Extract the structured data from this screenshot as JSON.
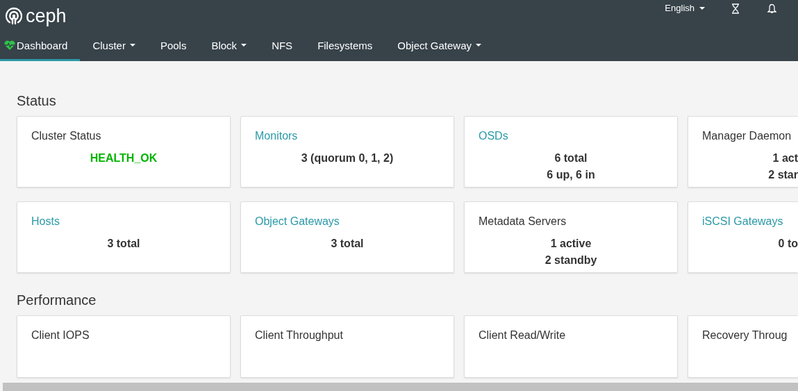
{
  "brand": "ceph",
  "language": {
    "label": "English"
  },
  "nav": [
    {
      "label": "Dashboard",
      "selected": true,
      "dropdown": false
    },
    {
      "label": "Cluster",
      "selected": false,
      "dropdown": true
    },
    {
      "label": "Pools",
      "selected": false,
      "dropdown": false
    },
    {
      "label": "Block",
      "selected": false,
      "dropdown": true
    },
    {
      "label": "NFS",
      "selected": false,
      "dropdown": false
    },
    {
      "label": "Filesystems",
      "selected": false,
      "dropdown": false
    },
    {
      "label": "Object Gateway",
      "selected": false,
      "dropdown": true
    }
  ],
  "sections": [
    {
      "title": "Status",
      "cards": [
        {
          "title": "Cluster Status",
          "link": false,
          "kind": "health",
          "values": [
            "HEALTH_OK"
          ]
        },
        {
          "title": "Monitors",
          "link": true,
          "kind": "count",
          "values": [
            "3 (quorum 0, 1, 2)"
          ]
        },
        {
          "title": "OSDs",
          "link": true,
          "kind": "count",
          "values": [
            "6 total",
            "6 up, 6 in"
          ]
        },
        {
          "title": "Manager Daemon",
          "link": false,
          "kind": "count",
          "values": [
            "1 act",
            "2 star"
          ]
        },
        {
          "title": "Hosts",
          "link": true,
          "kind": "count",
          "values": [
            "3 total"
          ]
        },
        {
          "title": "Object Gateways",
          "link": true,
          "kind": "count",
          "values": [
            "3 total"
          ]
        },
        {
          "title": "Metadata Servers",
          "link": false,
          "kind": "count",
          "values": [
            "1 active",
            "2 standby"
          ]
        },
        {
          "title": "iSCSI Gateways",
          "link": true,
          "kind": "count",
          "values": [
            "0 to"
          ]
        }
      ]
    },
    {
      "title": "Performance",
      "cards": [
        {
          "title": "Client IOPS",
          "link": false,
          "kind": "chart"
        },
        {
          "title": "Client Throughput",
          "link": false,
          "kind": "chart"
        },
        {
          "title": "Client Read/Write",
          "link": false,
          "kind": "chart"
        },
        {
          "title": "Recovery Throug",
          "link": false,
          "kind": "chart"
        }
      ]
    }
  ]
}
